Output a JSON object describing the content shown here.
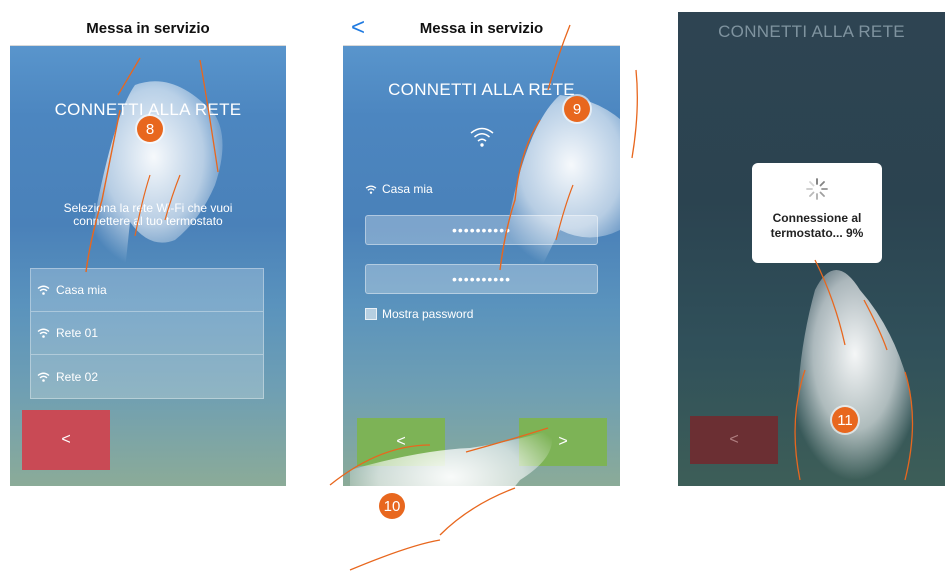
{
  "screen1": {
    "header_title": "Messa in servizio",
    "title": "CONNETTI ALLA RETE",
    "instruction_line1": "Seleziona la rete Wi-Fi che vuoi",
    "instruction_line2": "connettere al tuo termostato",
    "networks": [
      "Casa mia",
      "Rete 01",
      "Rete 02"
    ],
    "back_button": "<"
  },
  "screen2": {
    "header_title": "Messa in servizio",
    "back_icon": "<",
    "title": "CONNETTI ALLA RETE",
    "network_name": "Casa mia",
    "password_mask_1": "••••••••••",
    "password_mask_2": "••••••••••",
    "show_password": "Mostra password",
    "back_button": "<",
    "next_button": ">"
  },
  "screen3": {
    "title": "CONNETTI ALLA RETE",
    "popup_line1": "Connessione al",
    "popup_line2": "termostato... 9%",
    "back_button": "<"
  },
  "badges": [
    "8",
    "9",
    "10",
    "11"
  ],
  "colors": {
    "badge": "#e8671e",
    "back_red": "#c94a55",
    "next_green": "#7db356",
    "ios_blue": "#1f7ae0"
  }
}
